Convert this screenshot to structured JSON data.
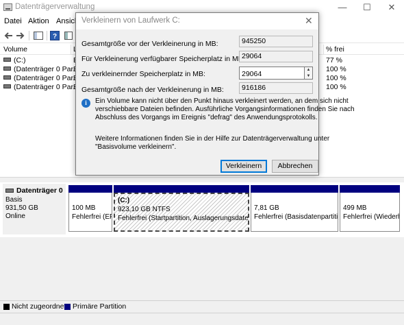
{
  "app": {
    "title": "Datenträgerverwaltung"
  },
  "window_controls": {
    "minimize": "—",
    "maximize": "☐",
    "close": "✕"
  },
  "menu": [
    "Datei",
    "Aktion",
    "Ansicht"
  ],
  "toolbar": {
    "icons": [
      "back-arrow-icon",
      "forward-arrow-icon",
      "console-tree-icon",
      "help-icon",
      "properties-icon"
    ]
  },
  "volume_list": {
    "columns": [
      "Volume",
      "Layout",
      "% frei"
    ],
    "rows": [
      {
        "name": "(C:)",
        "layout": "E",
        "free_pct": "77 %"
      },
      {
        "name": "(Datenträger 0 Par...",
        "layout": "E",
        "free_pct": "100 %"
      },
      {
        "name": "(Datenträger 0 Par...",
        "layout": "E",
        "free_pct": "100 %"
      },
      {
        "name": "(Datenträger 0 Par...",
        "layout": "E",
        "free_pct": "100 %"
      }
    ]
  },
  "disk": {
    "name": "Datenträger 0",
    "type": "Basis",
    "size": "931,50 GB",
    "status": "Online",
    "partitions": [
      {
        "title": "",
        "size": "100 MB",
        "status": "Fehlerfrei (EF"
      },
      {
        "title": "(C:)",
        "size": "923,10 GB NTFS",
        "status": "Fehlerfrei (Startpartition, Auslagerungsdatei, A"
      },
      {
        "title": "",
        "size": "7,81 GB",
        "status": "Fehlerfrei (Basisdatenpartitio"
      },
      {
        "title": "",
        "size": "499 MB",
        "status": "Fehlerfrei (Wiederh"
      }
    ]
  },
  "legend": [
    {
      "label": "Nicht zugeordnet",
      "color": "#000000"
    },
    {
      "label": "Primäre Partition",
      "color": "#00007f"
    }
  ],
  "dialog": {
    "title": "Verkleinern von Laufwerk C:",
    "close": "✕",
    "total_before_label": "Gesamtgröße vor der Verkleinerung in MB:",
    "total_before_value": "945250",
    "available_label": "Für Verkleinerung verfügbarer Speicherplatz in MB:",
    "available_value": "29064",
    "shrink_label": "Zu verkleinernder Speicherplatz in MB:",
    "shrink_value": "29064",
    "total_after_label": "Gesamtgröße nach der Verkleinerung in MB:",
    "total_after_value": "916186",
    "info_lines": [
      "Ein Volume kann nicht über den Punkt hinaus verkleinert werden, an dem sich nicht",
      "verschiebbare Dateien befinden. Ausführliche Vorgangsinformationen finden Sie nach",
      "Abschluss des Vorgangs im Ereignis \"defrag\" des Anwendungsprotokolls."
    ],
    "help_lines": [
      "Weitere Informationen finden Sie in der Hilfe zur Datenträgerverwaltung unter",
      "\"Basisvolume verkleinern\"."
    ],
    "shrink_button": "Verkleinern",
    "cancel_button": "Abbrechen"
  }
}
